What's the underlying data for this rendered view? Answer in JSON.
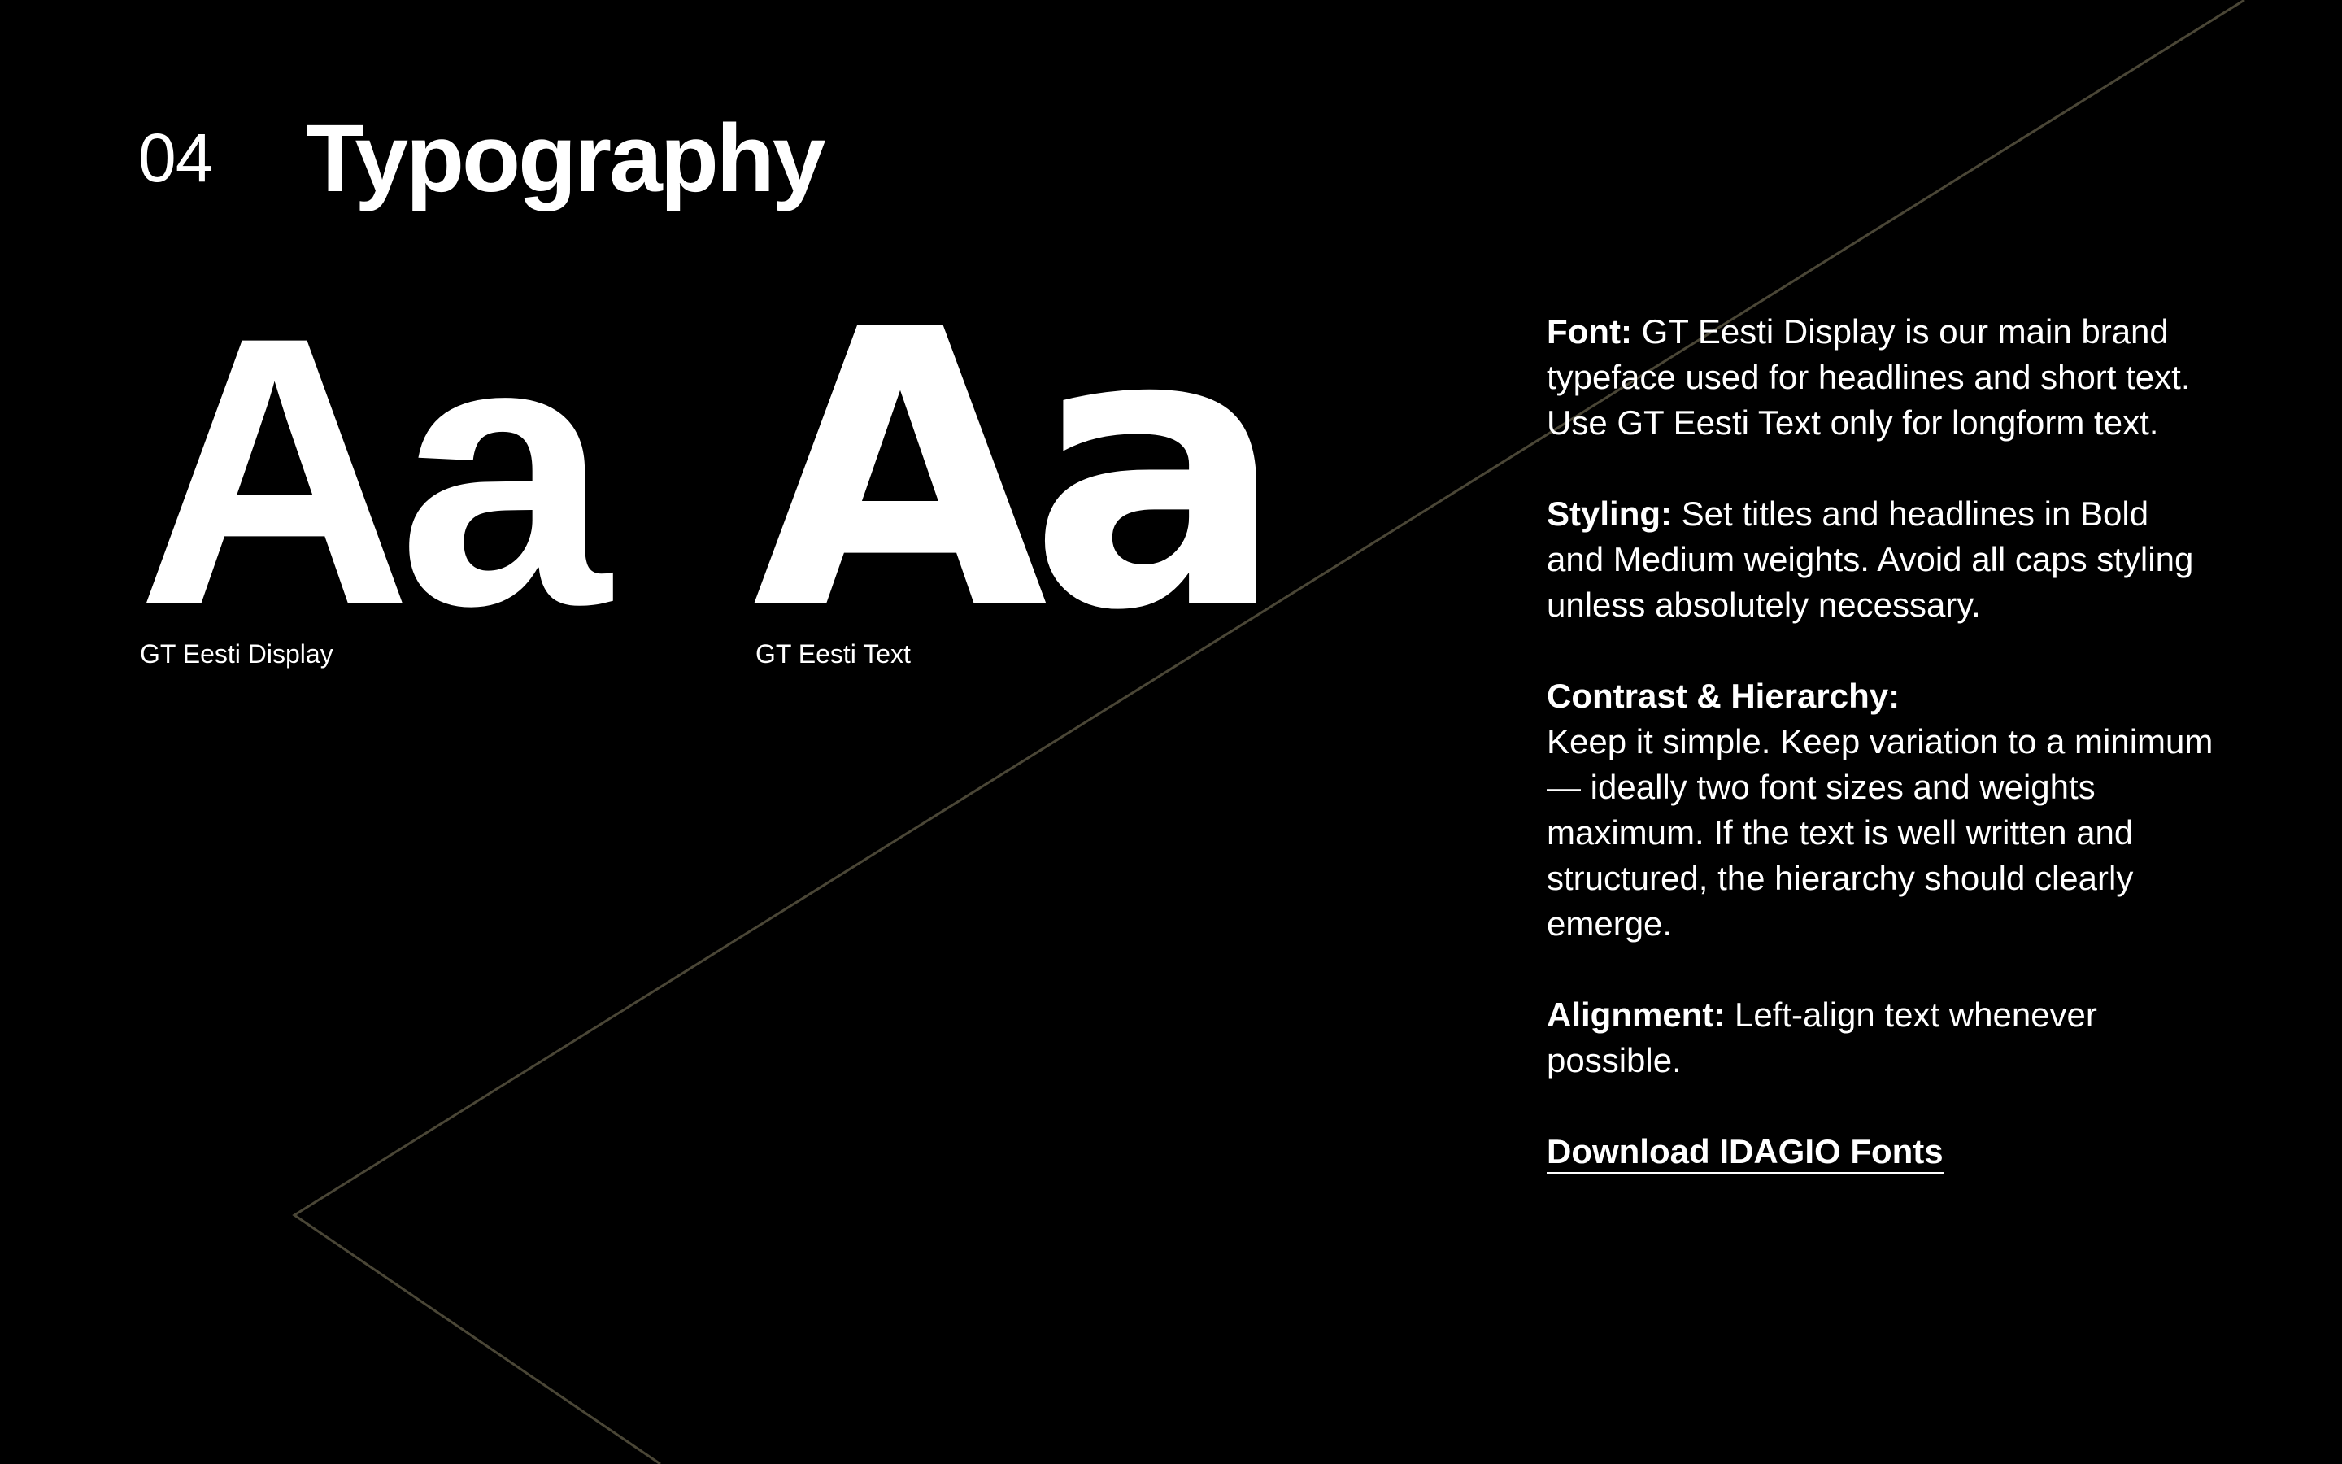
{
  "header": {
    "section_number": "04",
    "title": "Typography"
  },
  "specimens": [
    {
      "glyphs": "Aa",
      "label": "GT Eesti Display"
    },
    {
      "glyphs": "Aa",
      "label": "GT Eesti Text"
    }
  ],
  "guidelines": {
    "font": {
      "heading": "Font:",
      "body": "GT Eesti Display is our main brand typeface used for headlines and short text. Use GT Eesti Text only for longform text."
    },
    "styling": {
      "heading": "Styling:",
      "body": "Set titles and headlines in Bold and Medium weights. Avoid all caps styling unless absolutely necessary."
    },
    "contrast": {
      "heading": "Contrast & Hierarchy:",
      "body": "Keep it simple. Keep variation to a minimum — ideally two font sizes and weights maximum. If the text is well written and structured, the hierarchy should clearly emerge."
    },
    "alignment": {
      "heading": "Alignment:",
      "body": "Left-align text whenever possible."
    },
    "download_link": "Download IDAGIO Fonts"
  },
  "colors": {
    "background": "#000000",
    "text": "#ffffff",
    "decorative_line": "#4a4636"
  }
}
